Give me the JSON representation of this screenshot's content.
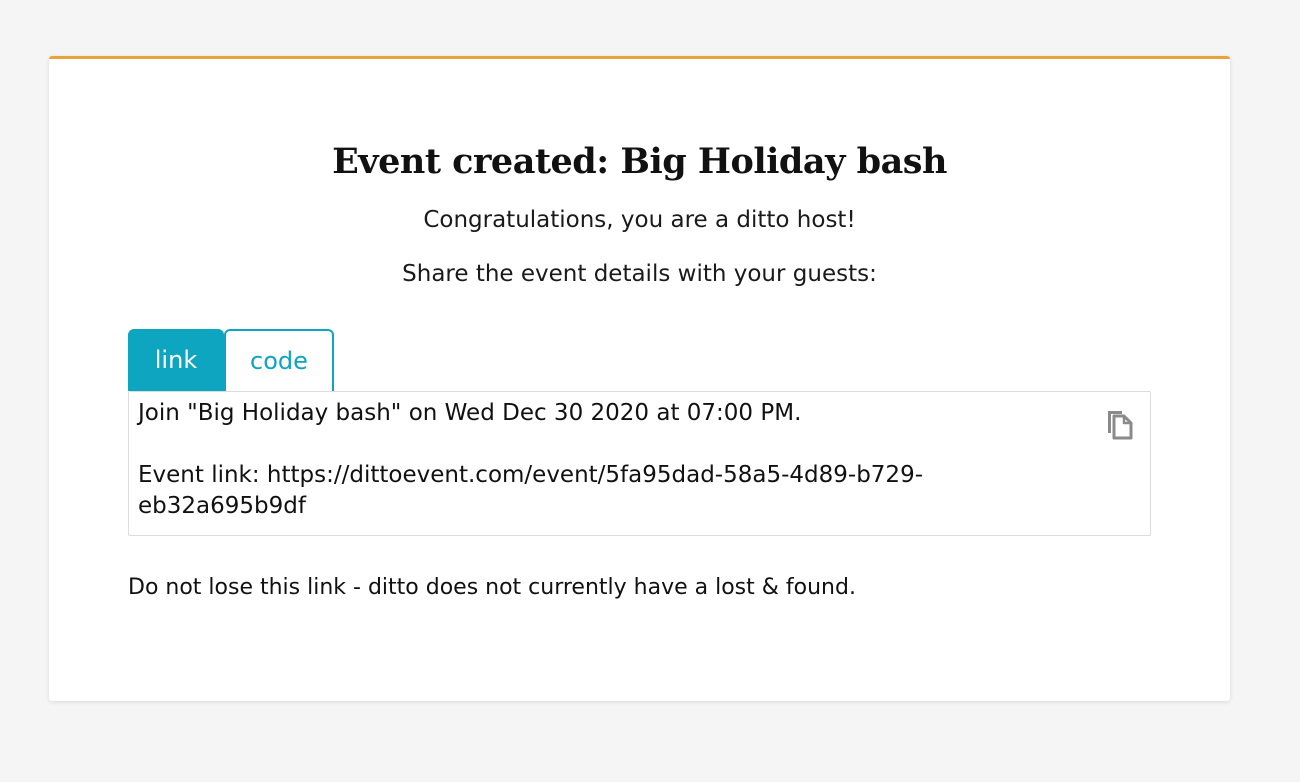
{
  "card": {
    "accent_color": "#e8a33a",
    "title": "Event created: Big Holiday bash",
    "congrats": "Congratulations, you are a ditto host!",
    "share_prompt": "Share the event details with your guests:"
  },
  "tabs": {
    "active": "link",
    "accent_color": "#0ea5c0",
    "items": [
      {
        "label": "link"
      },
      {
        "label": "code"
      }
    ]
  },
  "share_box": {
    "line1": "Join \"Big Holiday bash\" on Wed Dec 30 2020 at 07:00 PM.",
    "line2": "Event link: https://dittoevent.com/event/5fa95dad-58a5-4d89-b729-eb32a695b9df",
    "copy_icon": "copy-icon"
  },
  "warning": "Do not lose this link - ditto does not currently have a lost & found."
}
